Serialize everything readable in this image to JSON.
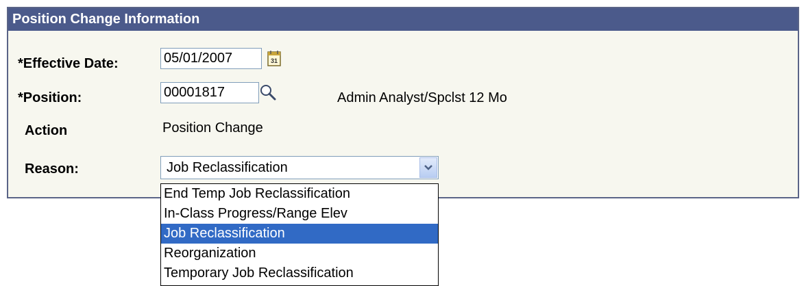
{
  "panel": {
    "title": "Position Change Information"
  },
  "fields": {
    "effective_date": {
      "label": "*Effective Date:",
      "value": "05/01/2007",
      "icon": "calendar-icon"
    },
    "position": {
      "label": "*Position:",
      "value": "00001817",
      "icon": "search-icon",
      "description": "Admin Analyst/Spclst 12 Mo"
    },
    "action": {
      "label": "Action",
      "value": "Position Change"
    },
    "reason": {
      "label": "Reason:",
      "selected": "Job Reclassification",
      "options": [
        "End Temp Job Reclassification",
        "In-Class Progress/Range Elev",
        "Job Reclassification",
        "Reorganization",
        "Temporary Job Reclassification"
      ]
    }
  },
  "colors": {
    "header_bg": "#4b5a8b",
    "panel_bg": "#f7f7ef",
    "highlight": "#316ac5"
  }
}
